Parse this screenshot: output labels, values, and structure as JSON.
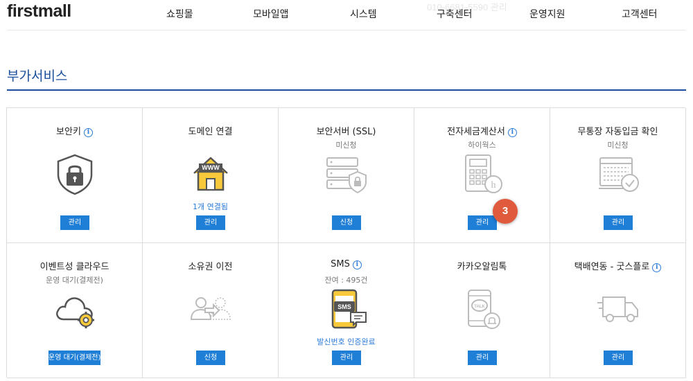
{
  "header": {
    "logo": "firstmall",
    "ghost_text": "010-6681-5590  관리",
    "nav": [
      "쇼핑몰",
      "모바일앱",
      "시스템",
      "구축센터",
      "운영지원",
      "고객센터"
    ]
  },
  "page": {
    "title": "부가서비스"
  },
  "cards": [
    {
      "title": "보안키",
      "info": "i",
      "sub": "",
      "link": "",
      "button": "관리",
      "icon": "shield-lock-icon"
    },
    {
      "title": "도메인 연결",
      "info": "",
      "sub": "",
      "link": "1개 연결됨",
      "button": "관리",
      "icon": "www-house-icon"
    },
    {
      "title": "보안서버 (SSL)",
      "info": "",
      "sub": "미신청",
      "link": "",
      "button": "신청",
      "icon": "server-shield-icon"
    },
    {
      "title": "전자세금계산서",
      "info": "i",
      "sub": "하이웍스",
      "link": "",
      "button": "관리",
      "icon": "calculator-icon"
    },
    {
      "title": "무통장 자동입금 확인",
      "info": "",
      "sub": "미신청",
      "link": "",
      "button": "관리",
      "icon": "bankbook-check-icon"
    },
    {
      "title": "이벤트성 클라우드",
      "info": "",
      "sub": "운영 대기(결제전)",
      "link": "",
      "button": "운영 대기(결제전)",
      "icon": "cloud-gear-icon"
    },
    {
      "title": "소유권 이전",
      "info": "",
      "sub": "",
      "link": "",
      "button": "신청",
      "icon": "ownership-transfer-icon"
    },
    {
      "title": "SMS",
      "info": "i",
      "sub": "잔여 : 495건",
      "link": "발신번호 인증완료",
      "button": "관리",
      "icon": "sms-phone-icon"
    },
    {
      "title": "카카오알림톡",
      "info": "",
      "sub": "",
      "link": "",
      "button": "관리",
      "icon": "kakao-talk-icon"
    },
    {
      "title": "택배연동 - 굿스플로",
      "info": "i",
      "sub": "",
      "link": "",
      "button": "관리",
      "icon": "delivery-truck-icon"
    }
  ],
  "badge": {
    "value": "3",
    "color": "#e05a3d"
  },
  "colors": {
    "accent": "#1b4e9b",
    "button": "#1f7ed6",
    "link": "#2b7bd9",
    "icon_active_fill": "#f8c93a"
  }
}
